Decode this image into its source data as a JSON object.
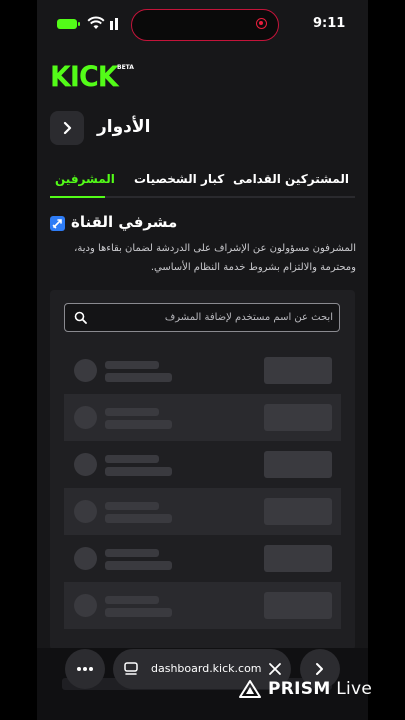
{
  "status_bar": {
    "time": "9:11"
  },
  "header": {
    "logo": "KICK",
    "logo_badge": "BETA"
  },
  "page": {
    "title": "الأدوار"
  },
  "tabs": [
    {
      "label": "المشرفين",
      "active": true
    },
    {
      "label": "كبار الشخصيات",
      "active": false
    },
    {
      "label": "المشتركين القدامى",
      "active": false
    }
  ],
  "section": {
    "title": "مشرفي القناة",
    "description": "المشرفون مسؤولون عن الإشراف على الدردشة لضمان بقاءها ودية، ومحترمة والالتزام بشروط خدمة النظام الأساسي."
  },
  "search": {
    "placeholder": "ابحث عن اسم مستخدم لإضافة المشرف",
    "value": ""
  },
  "moderator_rows": {
    "loading_placeholders": 6
  },
  "browser": {
    "url": "dashboard.kick.com"
  },
  "watermark": {
    "brand": "PRISM",
    "suffix": " Live"
  },
  "colors": {
    "accent": "#53fc18",
    "background": "#171719",
    "card": "#1f1f22",
    "skeleton": "#3a3a3f"
  }
}
